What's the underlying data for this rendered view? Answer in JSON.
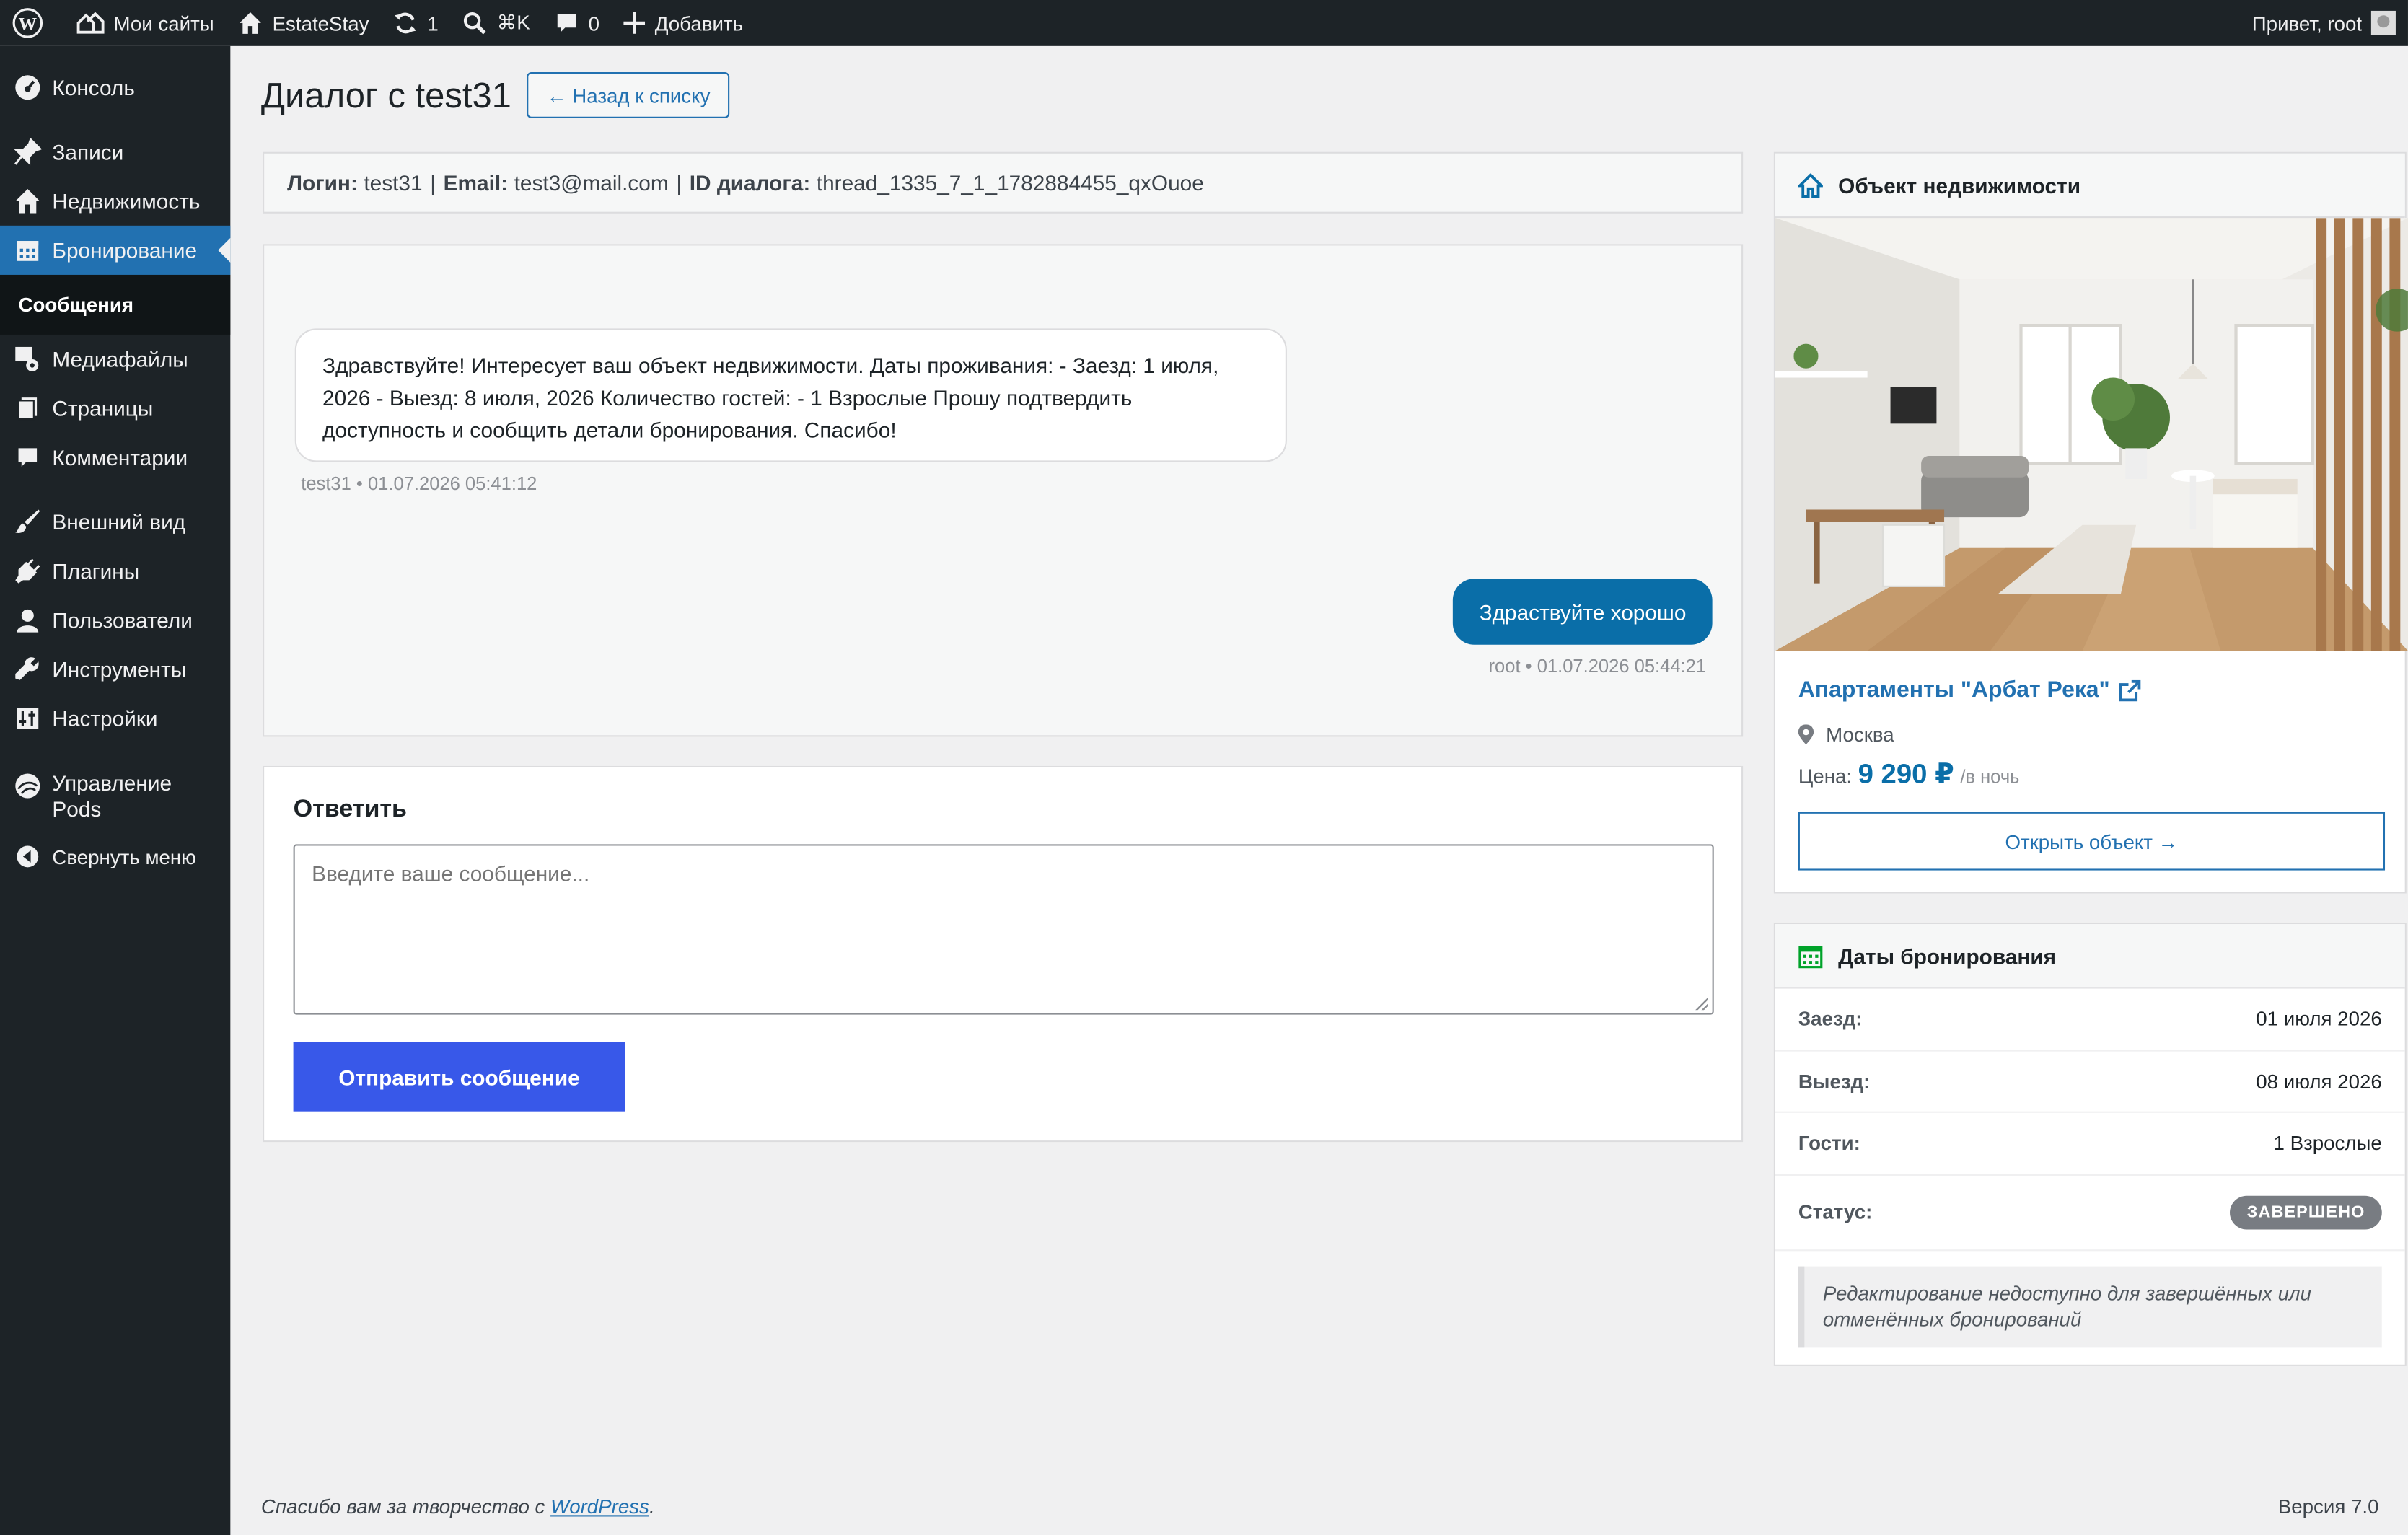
{
  "adminbar": {
    "my_sites": "Мои сайты",
    "site_name": "EstateStay",
    "updates_count": "1",
    "search_shortcut": "⌘K",
    "comments_count": "0",
    "add_new": "Добавить",
    "greeting": "Привет, root"
  },
  "sidebar": {
    "items": [
      {
        "label": "Консоль",
        "icon": "dashboard-icon"
      },
      {
        "label": "Записи",
        "icon": "pin-icon"
      },
      {
        "label": "Недвижимость",
        "icon": "home-icon"
      },
      {
        "label": "Бронирование",
        "icon": "calendar-icon"
      },
      {
        "label": "Медиафайлы",
        "icon": "media-icon"
      },
      {
        "label": "Страницы",
        "icon": "pages-icon"
      },
      {
        "label": "Комментарии",
        "icon": "comment-icon"
      },
      {
        "label": "Внешний вид",
        "icon": "brush-icon"
      },
      {
        "label": "Плагины",
        "icon": "plugin-icon"
      },
      {
        "label": "Пользователи",
        "icon": "user-icon"
      },
      {
        "label": "Инструменты",
        "icon": "wrench-icon"
      },
      {
        "label": "Настройки",
        "icon": "settings-icon"
      },
      {
        "label": "Управление Pods",
        "icon": "pods-icon"
      },
      {
        "label": "Свернуть меню",
        "icon": "collapse-icon"
      }
    ],
    "submenu": {
      "label": "Сообщения"
    }
  },
  "page": {
    "title": "Диалог с test31",
    "back_label": "← Назад к списку"
  },
  "info": {
    "login_label": "Логин:",
    "login": "test31",
    "email_label": "Email:",
    "email": "test3@mail.com",
    "thread_label": "ID диалога:",
    "thread_id": "thread_1335_7_1_1782884455_qxOuoe"
  },
  "messages": [
    {
      "text": "Здравствуйте! Интересует ваш объект недвижимости. Даты проживания: - Заезд: 1 июля, 2026 - Выезд: 8 июля, 2026 Количество гостей: - 1 Взрослые Прошу подтвердить доступность и сообщить детали бронирования. Спасибо!",
      "meta": "test31 • 01.07.2026 05:41:12"
    },
    {
      "text": "Здраствуйте хорошо",
      "meta": "root • 01.07.2026 05:44:21"
    }
  ],
  "reply": {
    "title": "Ответить",
    "placeholder": "Введите ваше сообщение...",
    "send_label": "Отправить сообщение"
  },
  "property": {
    "header": "Объект недвижимости",
    "name": "Апартаменты \"Арбат Река\"",
    "city": "Москва",
    "price_label": "Цена:",
    "price": "9 290 ₽",
    "price_unit": "/в ночь",
    "open_label": "Открыть объект →"
  },
  "booking": {
    "header": "Даты бронирования",
    "checkin_label": "Заезд:",
    "checkin": "01 июля 2026",
    "checkout_label": "Выезд:",
    "checkout": "08 июля 2026",
    "guests_label": "Гости:",
    "guests": "1 Взрослые",
    "status_label": "Статус:",
    "status": "ЗАВЕРШЕНО",
    "notice": "Редактирование недоступно для завершённых или отменённых бронирований"
  },
  "footer": {
    "thanks_prefix": "Спасибо вам за творчество с ",
    "wp_link": "WordPress",
    "thanks_suffix": ".",
    "version": "Версия 7.0"
  },
  "colors": {
    "adminbar": "#1d2327",
    "active_menu": "#2271b1",
    "primary_button": "#3858e9",
    "outgoing_bubble": "#0a6ea8",
    "status_badge": "#787c82"
  }
}
